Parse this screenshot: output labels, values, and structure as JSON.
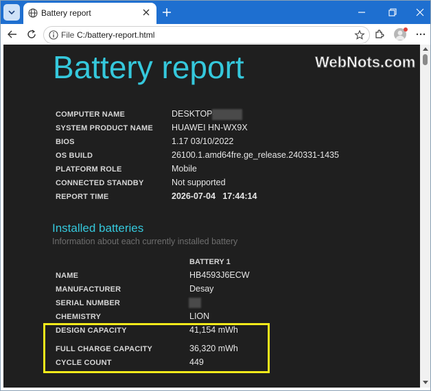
{
  "browser": {
    "tab_title": "Battery report",
    "address_prefix": "File",
    "url": "C:/battery-report.html"
  },
  "watermark": "WebNots.com",
  "report": {
    "title": "Battery report",
    "system_info": [
      {
        "label": "COMPUTER NAME",
        "value": "DESKTOP-"
      },
      {
        "label": "SYSTEM PRODUCT NAME",
        "value": "HUAWEI HN-WX9X"
      },
      {
        "label": "BIOS",
        "value": "1.17 03/10/2022"
      },
      {
        "label": "OS BUILD",
        "value": "26100.1.amd64fre.ge_release.240331-1435"
      },
      {
        "label": "PLATFORM ROLE",
        "value": "Mobile"
      },
      {
        "label": "CONNECTED STANDBY",
        "value": "Not supported"
      },
      {
        "label": "REPORT TIME",
        "value": "2026-07-04   17:44:14"
      }
    ],
    "installed_batteries": {
      "title": "Installed batteries",
      "subtitle": "Information about each currently installed battery",
      "column_header": "BATTERY 1",
      "rows": [
        {
          "label": "NAME",
          "value": "HB4593J6ECW"
        },
        {
          "label": "MANUFACTURER",
          "value": "Desay"
        },
        {
          "label": "SERIAL NUMBER",
          "value": ""
        },
        {
          "label": "CHEMISTRY",
          "value": "LION"
        },
        {
          "label": "DESIGN CAPACITY",
          "value": "41,154 mWh"
        },
        {
          "label": "FULL CHARGE CAPACITY",
          "value": "36,320 mWh"
        },
        {
          "label": "CYCLE COUNT",
          "value": "449"
        }
      ]
    }
  },
  "colors": {
    "accent": "#35c8dc",
    "page_background": "#1f1f1f",
    "highlight_box": "#f3ea1b",
    "tab_strip": "#1e6fd0"
  }
}
